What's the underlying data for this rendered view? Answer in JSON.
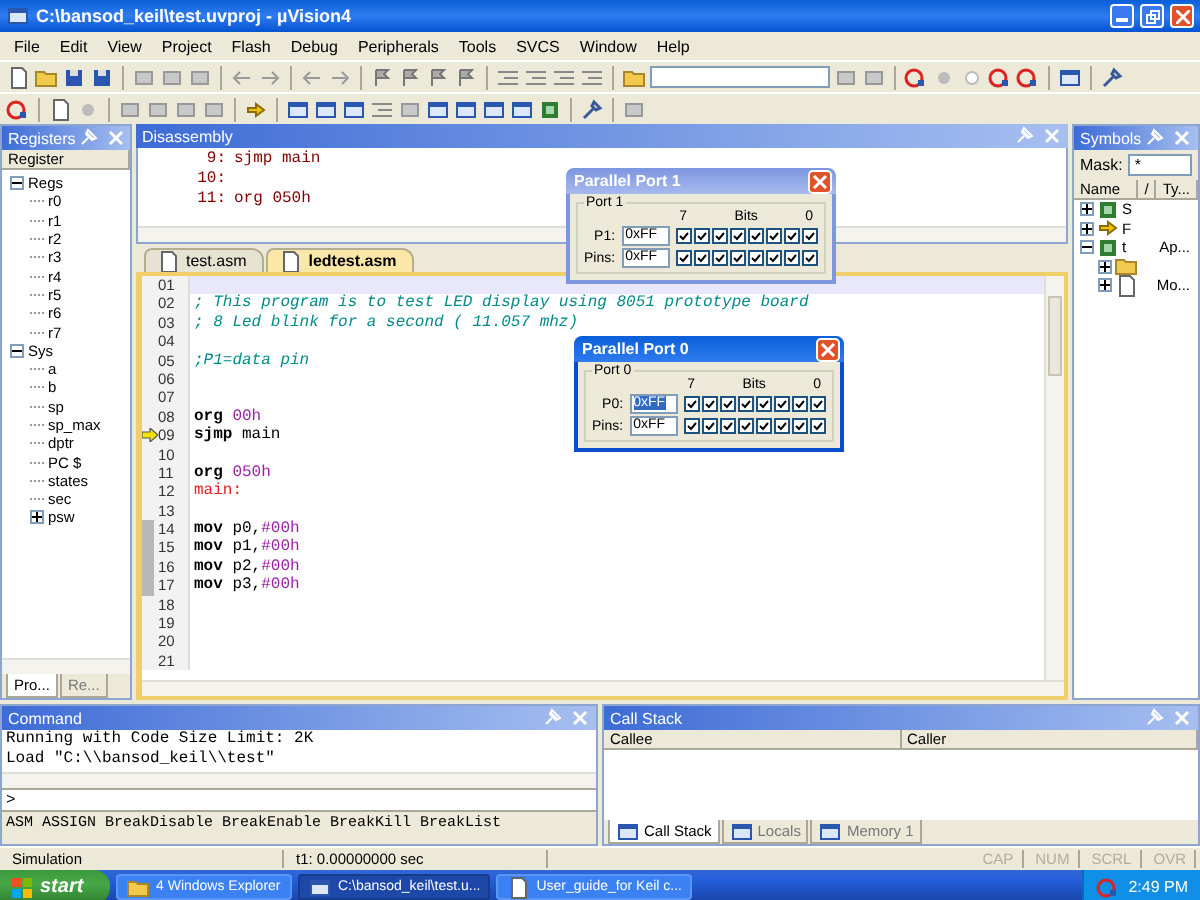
{
  "window": {
    "title": "C:\\bansod_keil\\test.uvproj - µVision4"
  },
  "menu": [
    "File",
    "Edit",
    "View",
    "Project",
    "Flash",
    "Debug",
    "Peripherals",
    "Tools",
    "SVCS",
    "Window",
    "Help"
  ],
  "registers": {
    "title": "Registers",
    "column": "Register",
    "tree": [
      {
        "label": "Regs",
        "expanded": true,
        "children": [
          {
            "label": "r0"
          },
          {
            "label": "r1"
          },
          {
            "label": "r2"
          },
          {
            "label": "r3"
          },
          {
            "label": "r4"
          },
          {
            "label": "r5"
          },
          {
            "label": "r6"
          },
          {
            "label": "r7"
          }
        ]
      },
      {
        "label": "Sys",
        "expanded": true,
        "children": [
          {
            "label": "a"
          },
          {
            "label": "b"
          },
          {
            "label": "sp"
          },
          {
            "label": "sp_max"
          },
          {
            "label": "dptr"
          },
          {
            "label": "PC $"
          },
          {
            "label": "states"
          },
          {
            "label": "sec"
          },
          {
            "label": "psw",
            "expanded": false
          }
        ]
      }
    ],
    "tabs": [
      {
        "label": "Pro...",
        "selected": true
      },
      {
        "label": "Re...",
        "selected": false
      }
    ]
  },
  "disassembly": {
    "title": "Disassembly",
    "lines": [
      {
        "num": "9:",
        "code": "sjmp main"
      },
      {
        "num": "10:"
      },
      {
        "num": "11:",
        "code": "org 050h"
      }
    ]
  },
  "editor": {
    "tabs": [
      {
        "label": "test.asm",
        "selected": false
      },
      {
        "label": "ledtest.asm",
        "selected": true
      }
    ],
    "lines": [
      {
        "number": "01",
        "cursor": true,
        "current": false,
        "executed": false
      },
      {
        "number": "02",
        "cursor": false,
        "current": false,
        "executed": false,
        "tokens": [
          {
            "kind": "comment",
            "text": "; This program is to test LED display using 8051 prototype board"
          }
        ]
      },
      {
        "number": "03",
        "cursor": false,
        "current": false,
        "executed": false,
        "tokens": [
          {
            "kind": "comment",
            "text": "; 8 Led blink for a second ( 11.057 mhz)"
          }
        ]
      },
      {
        "number": "04",
        "cursor": false,
        "current": false,
        "executed": false
      },
      {
        "number": "05",
        "cursor": false,
        "current": false,
        "executed": false,
        "tokens": [
          {
            "kind": "comment",
            "text": ";P1=data pin"
          }
        ]
      },
      {
        "number": "06",
        "cursor": false,
        "current": false,
        "executed": false
      },
      {
        "number": "07",
        "cursor": false,
        "current": false,
        "executed": false
      },
      {
        "number": "08",
        "cursor": false,
        "current": false,
        "executed": false,
        "tokens": [
          {
            "kind": "keyword",
            "text": "org "
          },
          {
            "kind": "number",
            "text": "00h"
          }
        ]
      },
      {
        "number": "09",
        "cursor": false,
        "current": true,
        "executed": false,
        "tokens": [
          {
            "kind": "keyword",
            "text": "sjmp"
          },
          {
            "kind": "plain",
            "text": " main"
          }
        ]
      },
      {
        "number": "10",
        "cursor": false,
        "current": false,
        "executed": false
      },
      {
        "number": "11",
        "cursor": false,
        "current": false,
        "executed": false,
        "tokens": [
          {
            "kind": "keyword",
            "text": "org "
          },
          {
            "kind": "number",
            "text": "050h"
          }
        ]
      },
      {
        "number": "12",
        "cursor": false,
        "current": false,
        "executed": false,
        "tokens": [
          {
            "kind": "label",
            "text": "main:"
          }
        ]
      },
      {
        "number": "13",
        "cursor": false,
        "current": false,
        "executed": false
      },
      {
        "number": "14",
        "cursor": false,
        "current": false,
        "executed": true,
        "tokens": [
          {
            "kind": "keyword",
            "text": "mov"
          },
          {
            "kind": "plain",
            "text": " p0,"
          },
          {
            "kind": "number",
            "text": "#00h"
          }
        ]
      },
      {
        "number": "15",
        "cursor": false,
        "current": false,
        "executed": true,
        "tokens": [
          {
            "kind": "keyword",
            "text": "mov"
          },
          {
            "kind": "plain",
            "text": " p1,"
          },
          {
            "kind": "number",
            "text": "#00h"
          }
        ]
      },
      {
        "number": "16",
        "cursor": false,
        "current": false,
        "executed": true,
        "tokens": [
          {
            "kind": "keyword",
            "text": "mov"
          },
          {
            "kind": "plain",
            "text": " p2,"
          },
          {
            "kind": "number",
            "text": "#00h"
          }
        ]
      },
      {
        "number": "17",
        "cursor": false,
        "current": false,
        "executed": true,
        "tokens": [
          {
            "kind": "keyword",
            "text": "mov"
          },
          {
            "kind": "plain",
            "text": " p3,"
          },
          {
            "kind": "number",
            "text": "#00h"
          }
        ]
      },
      {
        "number": "18",
        "cursor": false,
        "current": false,
        "executed": false
      },
      {
        "number": "19",
        "cursor": false,
        "current": false,
        "executed": false
      },
      {
        "number": "20",
        "cursor": false,
        "current": false,
        "executed": false
      },
      {
        "number": "21",
        "cursor": false,
        "current": false,
        "executed": false
      }
    ]
  },
  "symbols": {
    "title": "Symbols",
    "mask_label": "Mask:",
    "mask": "*",
    "columns": [
      "Name",
      "/",
      "Ty..."
    ],
    "rows": [
      {
        "name": "S",
        "expanded": false,
        "kind": "vt"
      },
      {
        "name": "F",
        "expanded": false,
        "kind": "func"
      },
      {
        "name": "t",
        "type": "Ap...",
        "expanded": true,
        "kind": "app",
        "children": [
          {
            "expanded": false,
            "kind": "folder"
          },
          {
            "type": "Mo...",
            "expanded": false,
            "kind": "module"
          }
        ]
      }
    ]
  },
  "dialogs": [
    {
      "title": "Parallel Port 1",
      "group": "Port 1",
      "port_label": "P1:",
      "value": "0xFF",
      "value_selected": false,
      "bits_high": "7",
      "bits_label": "Bits",
      "bits_low": "0",
      "bits": [
        true,
        true,
        true,
        true,
        true,
        true,
        true,
        true
      ],
      "pins_label": "Pins:",
      "pins_value": "0xFF",
      "pins": [
        true,
        true,
        true,
        true,
        true,
        true,
        true,
        true
      ]
    },
    {
      "title": "Parallel Port 0",
      "group": "Port 0",
      "port_label": "P0:",
      "value": "0xFF",
      "value_selected": true,
      "bits_high": "7",
      "bits_label": "Bits",
      "bits_low": "0",
      "bits": [
        true,
        true,
        true,
        true,
        true,
        true,
        true,
        true
      ],
      "pins_label": "Pins:",
      "pins_value": "0xFF",
      "pins": [
        true,
        true,
        true,
        true,
        true,
        true,
        true,
        true
      ]
    }
  ],
  "command": {
    "title": "Command",
    "output": [
      "Running with Code Size Limit: 2K",
      "Load \"C:\\\\bansod_keil\\\\test\""
    ],
    "prompt": ">",
    "help": "ASM ASSIGN BreakDisable BreakEnable BreakKill BreakList"
  },
  "call_stack": {
    "title": "Call Stack",
    "columns": [
      "Callee",
      "Caller"
    ],
    "tabs": [
      {
        "label": "Call Stack",
        "selected": true
      },
      {
        "label": "Locals",
        "selected": false
      },
      {
        "label": "Memory 1",
        "selected": false
      }
    ]
  },
  "status_bar": {
    "mode": "Simulation",
    "time": "t1: 0.00000000 sec",
    "indicators": [
      {
        "label": "CAP",
        "on": false
      },
      {
        "label": "NUM",
        "on": false
      },
      {
        "label": "SCRL",
        "on": false
      },
      {
        "label": "OVR",
        "on": false
      }
    ]
  },
  "taskbar": {
    "start": "start",
    "buttons": [
      {
        "label": "4 Windows Explorer",
        "selected": false,
        "kind": "folder"
      },
      {
        "label": "C:\\bansod_keil\\test.u...",
        "selected": true,
        "kind": "app"
      },
      {
        "label": "User_guide_for Keil c...",
        "selected": false,
        "kind": "doc"
      }
    ],
    "clock": "2:49 PM"
  }
}
